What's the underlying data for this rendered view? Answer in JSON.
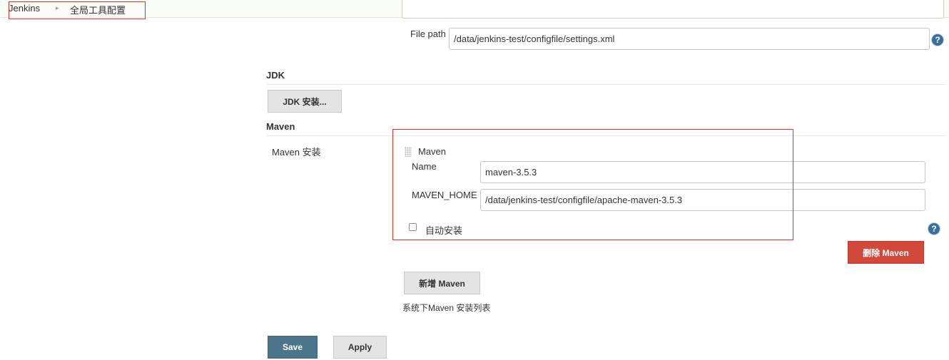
{
  "breadcrumb": {
    "items": [
      "Jenkins",
      "全局工具配置"
    ],
    "separator": "▸"
  },
  "settings_file": {
    "label": "File path",
    "value": "/data/jenkins-test/configfile/settings.xml"
  },
  "jdk": {
    "title": "JDK",
    "install_button": "JDK 安装..."
  },
  "maven": {
    "title": "Maven",
    "installations_label": "Maven 安装",
    "block_title": "Maven",
    "name_label": "Name",
    "name_value": "maven-3.5.3",
    "home_label": "MAVEN_HOME",
    "home_value": "/data/jenkins-test/configfile/apache-maven-3.5.3",
    "auto_install_label": "自动安装",
    "auto_install_checked": false,
    "delete_button": "删除 Maven",
    "add_button": "新增 Maven",
    "list_description": "系统下Maven 安装列表"
  },
  "actions": {
    "save": "Save",
    "apply": "Apply"
  },
  "help_glyph": "?",
  "colors": {
    "highlight_box": "#e0322a",
    "delete_button": "#d24939",
    "save_button": "#4b758b",
    "help_icon": "#3c6e9c"
  }
}
